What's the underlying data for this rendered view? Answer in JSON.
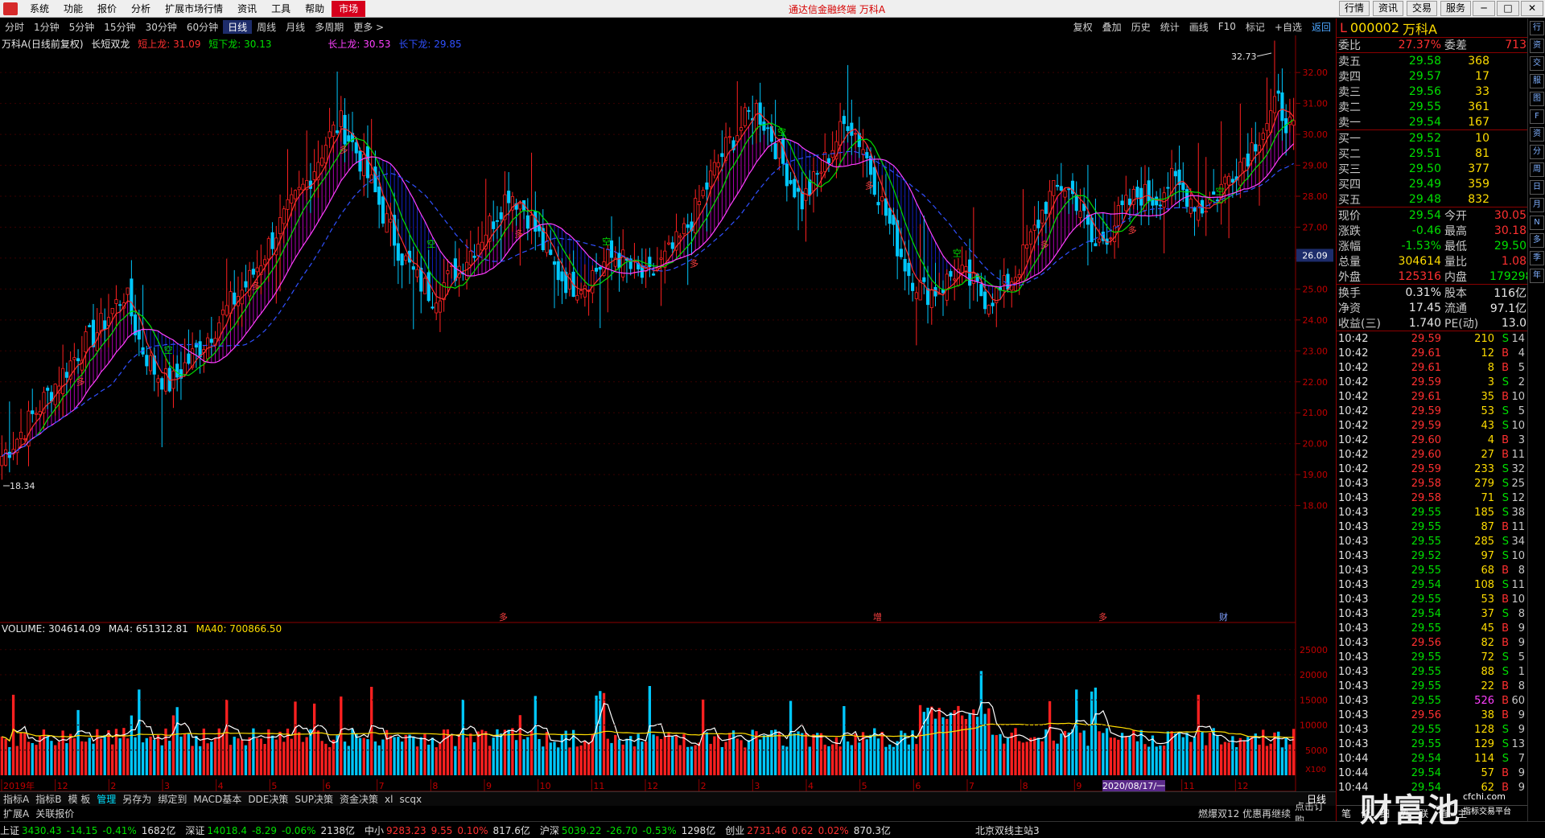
{
  "menu": {
    "items": [
      "系统",
      "功能",
      "报价",
      "分析",
      "扩展市场行情",
      "资讯",
      "工具",
      "帮助",
      "市场"
    ],
    "title": "通达信金融终端 万科A",
    "right_buttons": [
      "行情",
      "资讯",
      "交易",
      "服务"
    ]
  },
  "periods": [
    "分时",
    "1分钟",
    "5分钟",
    "15分钟",
    "30分钟",
    "60分钟",
    "日线",
    "周线",
    "月线",
    "多周期",
    "更多 >"
  ],
  "active_period": "日线",
  "toolbar_right": [
    "复权",
    "叠加",
    "历史",
    "统计",
    "画线",
    "F10",
    "标记",
    "+自选",
    "返回"
  ],
  "chart_legend": {
    "stock": "万科A(日线前复权)",
    "indicator": "长短双龙",
    "items": [
      {
        "label": "短上龙: 31.09",
        "color": "#ff3030"
      },
      {
        "label": "短下龙: 30.13",
        "color": "#00e000"
      },
      {
        "label": "长上龙: 30.53",
        "color": "#ff40ff"
      },
      {
        "label": "长下龙: 29.85",
        "color": "#3050ff"
      }
    ]
  },
  "chart_data": {
    "type": "candlestick",
    "y_axis": [
      32.0,
      31.0,
      30.0,
      29.0,
      28.0,
      27.0,
      26.0,
      25.0,
      24.0,
      23.0,
      22.0,
      21.0,
      20.0,
      19.0,
      18.0
    ],
    "ylim": [
      17.6,
      33.2
    ],
    "high_label": "32.73",
    "low_label": "18.34",
    "crosshair_price": "26.09",
    "x_labels": [
      "2019年",
      "12",
      "2",
      "3",
      "4",
      "5",
      "6",
      "7",
      "8",
      "9",
      "10",
      "11",
      "12",
      "2",
      "3",
      "4",
      "5",
      "6",
      "7",
      "8",
      "9",
      "10",
      "11",
      "12"
    ],
    "cursor_date": "2020/08/17/一",
    "event_markers": [
      "多",
      "增",
      "多",
      "财"
    ],
    "signal_labels": [
      "多",
      "空"
    ],
    "close_path": [
      19.6,
      20.2,
      20.9,
      21.6,
      22.3,
      23.0,
      23.5,
      24.2,
      24.9,
      23.2,
      22.3,
      21.9,
      22.6,
      23.2,
      23.9,
      24.6,
      25.2,
      26.1,
      27.0,
      27.8,
      28.6,
      29.7,
      30.4,
      29.5,
      28.4,
      27.2,
      26.1,
      25.3,
      24.8,
      25.3,
      25.9,
      26.6,
      27.3,
      28.2,
      27.6,
      26.6,
      25.6,
      25.1,
      25.3,
      25.8,
      26.1,
      25.6,
      25.3,
      25.9,
      26.5,
      27.4,
      28.5,
      29.5,
      30.2,
      30.9,
      30.0,
      28.8,
      27.8,
      28.6,
      29.6,
      30.5,
      29.6,
      28.1,
      26.7,
      25.5,
      24.9,
      25.0,
      25.6,
      25.2,
      24.7,
      24.9,
      25.6,
      26.7,
      27.9,
      28.4,
      27.8,
      26.3,
      26.9,
      27.6,
      28.1,
      27.9,
      28.5,
      28.1,
      27.6,
      28.1,
      28.8,
      29.4,
      30.2,
      31.0,
      30.0
    ],
    "volume": {
      "legend": {
        "vol": "VOLUME: 304614.09",
        "ma4": "MA4: 651312.81",
        "ma40": "MA40: 700866.50"
      },
      "y_axis": [
        "25000",
        "20000",
        "15000",
        "10000",
        "5000"
      ],
      "unit": "X100"
    }
  },
  "quote": {
    "code": "000002",
    "name": "万科A",
    "weibi": {
      "label": "委比",
      "value": "27.37%",
      "diff_label": "委差",
      "diff": "713"
    },
    "asks": [
      {
        "label": "卖五",
        "price": "29.58",
        "vol": "368"
      },
      {
        "label": "卖四",
        "price": "29.57",
        "vol": "17"
      },
      {
        "label": "卖三",
        "price": "29.56",
        "vol": "33"
      },
      {
        "label": "卖二",
        "price": "29.55",
        "vol": "361"
      },
      {
        "label": "卖一",
        "price": "29.54",
        "vol": "167"
      }
    ],
    "bids": [
      {
        "label": "买一",
        "price": "29.52",
        "vol": "10"
      },
      {
        "label": "买二",
        "price": "29.51",
        "vol": "81"
      },
      {
        "label": "买三",
        "price": "29.50",
        "vol": "377"
      },
      {
        "label": "买四",
        "price": "29.49",
        "vol": "359"
      },
      {
        "label": "买五",
        "price": "29.48",
        "vol": "832"
      }
    ],
    "stats": [
      {
        "l1": "现价",
        "v1": "29.54",
        "c1": "green",
        "l2": "今开",
        "v2": "30.05",
        "c2": "red"
      },
      {
        "l1": "涨跌",
        "v1": "-0.46",
        "c1": "green",
        "l2": "最高",
        "v2": "30.18",
        "c2": "red"
      },
      {
        "l1": "涨幅",
        "v1": "-1.53%",
        "c1": "green",
        "l2": "最低",
        "v2": "29.50",
        "c2": "green"
      },
      {
        "l1": "总量",
        "v1": "304614",
        "c1": "yellow",
        "l2": "量比",
        "v2": "1.08",
        "c2": "red"
      },
      {
        "l1": "外盘",
        "v1": "125316",
        "c1": "red",
        "l2": "内盘",
        "v2": "179298",
        "c2": "green"
      }
    ],
    "fundamentals": [
      {
        "l1": "换手",
        "v1": "0.31%",
        "l2": "股本",
        "v2": "116亿"
      },
      {
        "l1": "净资",
        "v1": "17.45",
        "l2": "流通",
        "v2": "97.1亿"
      },
      {
        "l1": "收益(三)",
        "v1": "1.740",
        "l2": "PE(动)",
        "v2": "13.0"
      }
    ],
    "ticks": [
      {
        "t": "10:42",
        "p": "29.59",
        "v": "210",
        "d": "S",
        "n": "14"
      },
      {
        "t": "10:42",
        "p": "29.61",
        "v": "12",
        "d": "B",
        "n": "4"
      },
      {
        "t": "10:42",
        "p": "29.61",
        "v": "8",
        "d": "B",
        "n": "5"
      },
      {
        "t": "10:42",
        "p": "29.59",
        "v": "3",
        "d": "S",
        "n": "2"
      },
      {
        "t": "10:42",
        "p": "29.61",
        "v": "35",
        "d": "B",
        "n": "10"
      },
      {
        "t": "10:42",
        "p": "29.59",
        "v": "53",
        "d": "S",
        "n": "5"
      },
      {
        "t": "10:42",
        "p": "29.59",
        "v": "43",
        "d": "S",
        "n": "10"
      },
      {
        "t": "10:42",
        "p": "29.60",
        "v": "4",
        "d": "B",
        "n": "3"
      },
      {
        "t": "10:42",
        "p": "29.60",
        "v": "27",
        "d": "B",
        "n": "11"
      },
      {
        "t": "10:42",
        "p": "29.59",
        "v": "233",
        "d": "S",
        "n": "32"
      },
      {
        "t": "10:43",
        "p": "29.58",
        "v": "279",
        "d": "S",
        "n": "25"
      },
      {
        "t": "10:43",
        "p": "29.58",
        "v": "71",
        "d": "S",
        "n": "12"
      },
      {
        "t": "10:43",
        "p": "29.55",
        "v": "185",
        "d": "S",
        "n": "38"
      },
      {
        "t": "10:43",
        "p": "29.55",
        "v": "87",
        "d": "B",
        "n": "11"
      },
      {
        "t": "10:43",
        "p": "29.55",
        "v": "285",
        "d": "S",
        "n": "34"
      },
      {
        "t": "10:43",
        "p": "29.52",
        "v": "97",
        "d": "S",
        "n": "10"
      },
      {
        "t": "10:43",
        "p": "29.55",
        "v": "68",
        "d": "B",
        "n": "8"
      },
      {
        "t": "10:43",
        "p": "29.54",
        "v": "108",
        "d": "S",
        "n": "11"
      },
      {
        "t": "10:43",
        "p": "29.55",
        "v": "53",
        "d": "B",
        "n": "10"
      },
      {
        "t": "10:43",
        "p": "29.54",
        "v": "37",
        "d": "S",
        "n": "8"
      },
      {
        "t": "10:43",
        "p": "29.55",
        "v": "45",
        "d": "B",
        "n": "9"
      },
      {
        "t": "10:43",
        "p": "29.56",
        "v": "82",
        "d": "B",
        "n": "9"
      },
      {
        "t": "10:43",
        "p": "29.55",
        "v": "72",
        "d": "S",
        "n": "5"
      },
      {
        "t": "10:43",
        "p": "29.55",
        "v": "88",
        "d": "S",
        "n": "1"
      },
      {
        "t": "10:43",
        "p": "29.55",
        "v": "22",
        "d": "B",
        "n": "8"
      },
      {
        "t": "10:43",
        "p": "29.55",
        "v": "526",
        "d": "B",
        "n": "60",
        "vc": "magenta"
      },
      {
        "t": "10:43",
        "p": "29.56",
        "v": "38",
        "d": "B",
        "n": "9"
      },
      {
        "t": "10:43",
        "p": "29.55",
        "v": "128",
        "d": "S",
        "n": "9"
      },
      {
        "t": "10:43",
        "p": "29.55",
        "v": "129",
        "d": "S",
        "n": "13"
      },
      {
        "t": "10:44",
        "p": "29.54",
        "v": "114",
        "d": "S",
        "n": "7"
      },
      {
        "t": "10:44",
        "p": "29.54",
        "v": "57",
        "d": "B",
        "n": "9"
      },
      {
        "t": "10:44",
        "p": "29.54",
        "v": "62",
        "d": "B",
        "n": "9"
      }
    ],
    "bottom_tabs": [
      "笔",
      "价",
      "细",
      "势",
      "联",
      "值",
      "主"
    ]
  },
  "bottom_tabs": [
    "指标A",
    "指标B",
    "模 板",
    "管理",
    "另存为",
    "绑定到",
    "MACD基本",
    "DDE决策",
    "SUP决策",
    "资金决策",
    "xl",
    "scqx"
  ],
  "bottom_tabs_active": "管理",
  "bottom_tabs2": [
    "扩展A",
    "关联报价"
  ],
  "period_button": "日线",
  "status": {
    "indices": [
      {
        "name": "上证",
        "val": "3430.43",
        "chg": "-14.15",
        "pct": "-0.41%",
        "amt": "1682亿",
        "color": "green"
      },
      {
        "name": "深证",
        "val": "14018.4",
        "chg": "-8.29",
        "pct": "-0.06%",
        "amt": "2138亿",
        "color": "green"
      },
      {
        "name": "中小",
        "val": "9283.23",
        "chg": "9.55",
        "pct": "0.10%",
        "amt": "817.6亿",
        "color": "red"
      },
      {
        "name": "沪深",
        "val": "5039.22",
        "chg": "-26.70",
        "pct": "-0.53%",
        "amt": "1298亿",
        "color": "green"
      },
      {
        "name": "创业",
        "val": "2731.46",
        "chg": "0.62",
        "pct": "0.02%",
        "amt": "870.3亿",
        "color": "red"
      }
    ],
    "server": "北京双线主站3",
    "ad": "燃爆双12 优惠再继续",
    "order": "点击订购"
  },
  "watermark": {
    "main": "财富池",
    "sub": "cfchi.com",
    "sub2": "指标交易平台"
  },
  "side_icons": [
    "行",
    "资",
    "交",
    "服",
    "图",
    "F",
    "资",
    "分",
    "周",
    "日",
    "月",
    "N",
    "多",
    "季",
    "年"
  ],
  "colors": {
    "up": "#ff3030",
    "down": "#00e0ff",
    "ma_yellow": "#ffdd00",
    "grid": "#5a0000"
  }
}
